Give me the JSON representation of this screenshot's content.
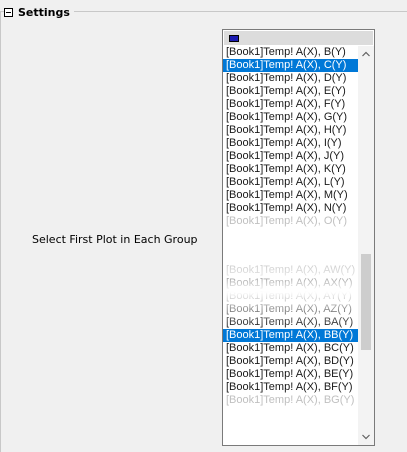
{
  "settings": {
    "title": "Settings",
    "field_label": "Select First Plot in Each Group"
  },
  "listbox": {
    "swatch_color": "#1a1ab0",
    "top_items": [
      {
        "label": "[Book1]Temp! A(X), B(Y)",
        "selected": false,
        "faded": false
      },
      {
        "label": "[Book1]Temp! A(X), C(Y)",
        "selected": true,
        "faded": false
      },
      {
        "label": "[Book1]Temp! A(X), D(Y)",
        "selected": false,
        "faded": false
      },
      {
        "label": "[Book1]Temp! A(X), E(Y)",
        "selected": false,
        "faded": false
      },
      {
        "label": "[Book1]Temp! A(X), F(Y)",
        "selected": false,
        "faded": false
      },
      {
        "label": "[Book1]Temp! A(X), G(Y)",
        "selected": false,
        "faded": false
      },
      {
        "label": "[Book1]Temp! A(X), H(Y)",
        "selected": false,
        "faded": false
      },
      {
        "label": "[Book1]Temp! A(X), I(Y)",
        "selected": false,
        "faded": false
      },
      {
        "label": "[Book1]Temp! A(X), J(Y)",
        "selected": false,
        "faded": false
      },
      {
        "label": "[Book1]Temp! A(X), K(Y)",
        "selected": false,
        "faded": false
      },
      {
        "label": "[Book1]Temp! A(X), L(Y)",
        "selected": false,
        "faded": false
      },
      {
        "label": "[Book1]Temp! A(X), M(Y)",
        "selected": false,
        "faded": false
      },
      {
        "label": "[Book1]Temp! A(X), N(Y)",
        "selected": false,
        "faded": false
      },
      {
        "label": "[Book1]Temp! A(X), O(Y)",
        "selected": false,
        "faded": true
      }
    ],
    "bottom_items": [
      {
        "label": "[Book1]Temp! A(X), AW(Y)",
        "selected": false,
        "faded": true
      },
      {
        "label": "[Book1]Temp! A(X), AX(Y)",
        "selected": false,
        "faded": false
      },
      {
        "label": "[Book1]Temp! A(X), AY(Y)",
        "selected": false,
        "faded": false
      },
      {
        "label": "[Book1]Temp! A(X), AZ(Y)",
        "selected": false,
        "faded": false
      },
      {
        "label": "[Book1]Temp! A(X), BA(Y)",
        "selected": false,
        "faded": false
      },
      {
        "label": "[Book1]Temp! A(X), BB(Y)",
        "selected": true,
        "faded": false
      },
      {
        "label": "[Book1]Temp! A(X), BC(Y)",
        "selected": false,
        "faded": false
      },
      {
        "label": "[Book1]Temp! A(X), BD(Y)",
        "selected": false,
        "faded": false
      },
      {
        "label": "[Book1]Temp! A(X), BE(Y)",
        "selected": false,
        "faded": false
      },
      {
        "label": "[Book1]Temp! A(X), BF(Y)",
        "selected": false,
        "faded": false
      },
      {
        "label": "[Book1]Temp! A(X), BG(Y)",
        "selected": false,
        "faded": true
      }
    ]
  }
}
